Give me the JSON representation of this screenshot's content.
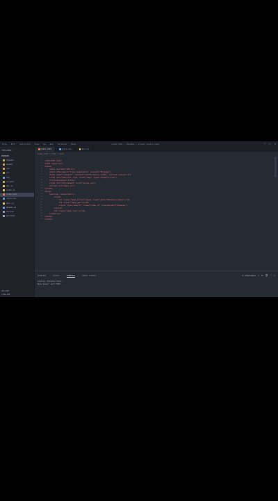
{
  "window": {
    "title": "index.html — Pokedex — Visual Studio Code",
    "menu": [
      "File",
      "Edit",
      "Selection",
      "View",
      "Go",
      "Run",
      "Terminal",
      "Help"
    ],
    "controls": [
      "—",
      "☐",
      "✕"
    ]
  },
  "sidebar": {
    "title": "EXPLORER",
    "section": "POKEDEX",
    "items": [
      {
        "label": "Pokedex",
        "color": "#c9a84c"
      },
      {
        "label": "assets",
        "color": "#c9a84c"
      },
      {
        "label": "css",
        "color": "#c9a84c"
      },
      {
        "label": "src",
        "color": "#c9a84c"
      },
      {
        "label": "img",
        "color": "#6e9fd4"
      },
      {
        "label": "scripts",
        "color": "#c9a84c"
      },
      {
        "label": "api.js",
        "color": "#e0c46c"
      },
      {
        "label": "index.js",
        "color": "#e0c46c"
      },
      {
        "label": "index.html",
        "color": "#e07a4a"
      },
      {
        "label": "style.css",
        "color": "#5b9bd5"
      },
      {
        "label": "main.js",
        "color": "#e0c46c"
      },
      {
        "label": "README.md",
        "color": "#6e9fd4"
      },
      {
        "label": "favicon",
        "color": "#a08cd0"
      },
      {
        "label": "manifest",
        "color": "#9aa1b0"
      }
    ],
    "selected_index": 8,
    "outline": "OUTLINE",
    "timeline": "TIMELINE"
  },
  "tabs": [
    {
      "label": "index.html",
      "active": true,
      "color": "#e07a4a"
    },
    {
      "label": "style.css",
      "active": false,
      "color": "#5b9bd5"
    },
    {
      "label": "main.js",
      "active": false,
      "color": "#e0c46c"
    }
  ],
  "breadcrumb": "index.html > html > head",
  "code": {
    "lines": [
      "<!DOCTYPE html>",
      "<html lang=\"en\">",
      "<head>",
      "    <meta charset=\"UTF-8\">",
      "    <meta http-equiv=\"X-UA-Compatible\" content=\"IE=edge\">",
      "    <meta name=\"viewport\" content=\"width=device-width, initial-scale=1.0\">",
      "    <link rel=\"shortcut icon\" href=\"img/\" type=\"image/x-icon\">",
      "    <title>Pokedex</title>",
      "    <link rel=\"stylesheet\" href=\"style.css\">",
      "    <script src=\"main.js\">",
      "</head>",
      "<body>",
      "    <section class=\"main\">",
      "        <form>",
      "            <h1 class=\"name_title\"><span class=\"poke\">Pokedex</span></h1>",
      "            <h2 class=\"name_gen\"></h2>",
      "            <input type=\"search\" class=\"name_id\" placeholder=\"Pokemon\">",
      "        </form>",
      "        <h2 class=\"name_list\"></h2>",
      "    </section>",
      "</body>",
      "</html>"
    ],
    "indent_colors": {
      "tag": "#e06c75",
      "attr": "#d19a66",
      "string": "#98c379",
      "text": "#abb2bf"
    }
  },
  "panel": {
    "tabs": [
      "PROBLEMS",
      "OUTPUT",
      "TERMINAL",
      "DEBUG CONSOLE"
    ],
    "active_tab": 2,
    "terminal_lines": [
      "Loading /Pokedex/index...",
      "Node Ready: port 5500"
    ],
    "right_selector": "1: powershell",
    "right_icons": [
      "+",
      "⊞",
      "🗑",
      "^",
      "✕"
    ]
  }
}
